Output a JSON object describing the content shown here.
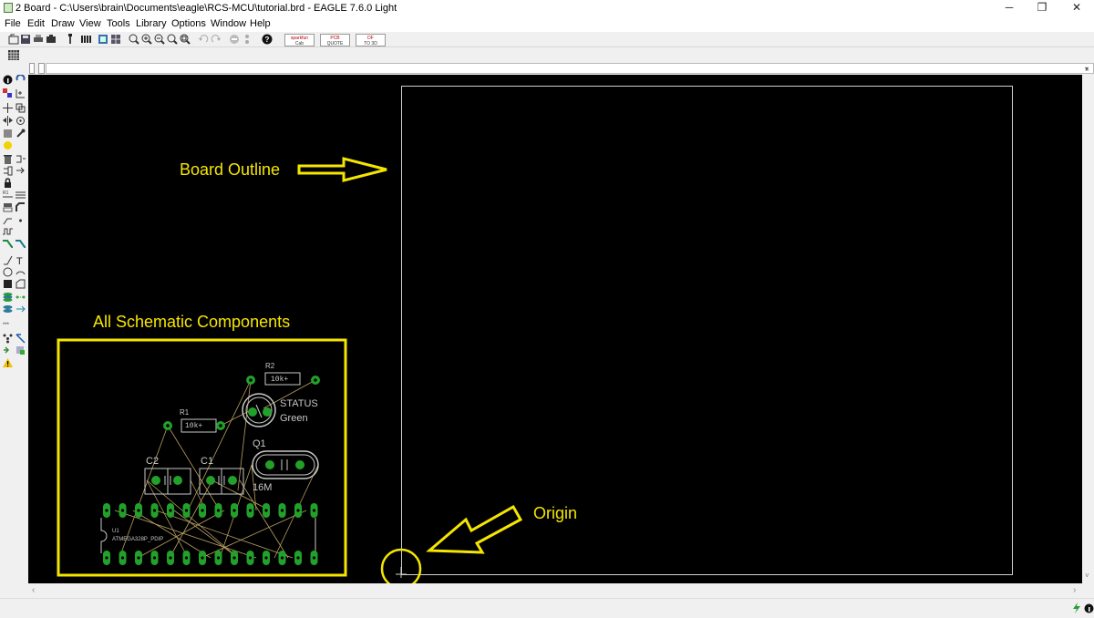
{
  "window": {
    "title": "2 Board - C:\\Users\\brain\\Documents\\eagle\\RCS-MCU\\tutorial.brd - EAGLE 7.6.0 Light",
    "minimize": "─",
    "restore": "❐",
    "close": "✕"
  },
  "menu": [
    "File",
    "Edit",
    "Draw",
    "View",
    "Tools",
    "Library",
    "Options",
    "Window",
    "Help"
  ],
  "toolbar": {
    "brand_buttons": [
      {
        "top": "sparkfun",
        "bottom": "Cab"
      },
      {
        "top": "PCB",
        "bottom": "QUOTE"
      },
      {
        "top": "DF",
        "bottom": "TO 3D"
      }
    ]
  },
  "annotations": {
    "board_outline": "Board Outline",
    "all_components": "All Schematic Components",
    "origin": "Origin",
    "accent_color": "#f5e600"
  },
  "parts": {
    "r2_name": "R2",
    "r2_value": "10k+",
    "r1_name": "R1",
    "r1_value": "10k+",
    "led_name": "STATUS",
    "led_value": "Green",
    "q1_name": "Q1",
    "q1_value": "16M",
    "c2_name": "C2",
    "c1_name": "C1",
    "u1_name": "U1",
    "u1_value": "ATMEGA328P_PDIP"
  },
  "colors": {
    "canvas": "#000000",
    "pad": "#22a02a",
    "silk": "#c8c8c8",
    "airwire": "#b8a060",
    "outline": "#d0d0d0"
  }
}
